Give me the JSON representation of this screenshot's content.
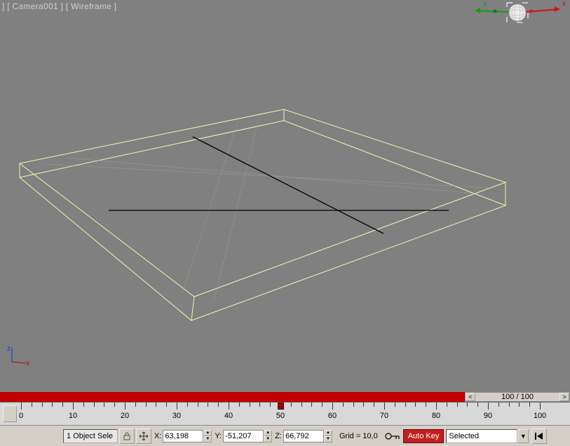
{
  "viewport": {
    "label": "] [ Camera001 ] [ Wireframe ]"
  },
  "axis_small": {
    "z": "z",
    "x": "x"
  },
  "viewcube": {
    "y": "y",
    "x": "x"
  },
  "timeline": {
    "position_readout": "100 / 100",
    "ticks": [
      0,
      10,
      20,
      30,
      40,
      50,
      60,
      70,
      80,
      90,
      100
    ],
    "current": 50
  },
  "status": {
    "selection": "1 Object Sele",
    "coords": {
      "x_label": "X:",
      "x": "63,198",
      "y_label": "Y:",
      "y": "-51,207",
      "z_label": "Z:",
      "z": "66,792"
    },
    "grid": "Grid = 10,0",
    "autokey": "Auto Key",
    "key_filter": "Selected"
  }
}
